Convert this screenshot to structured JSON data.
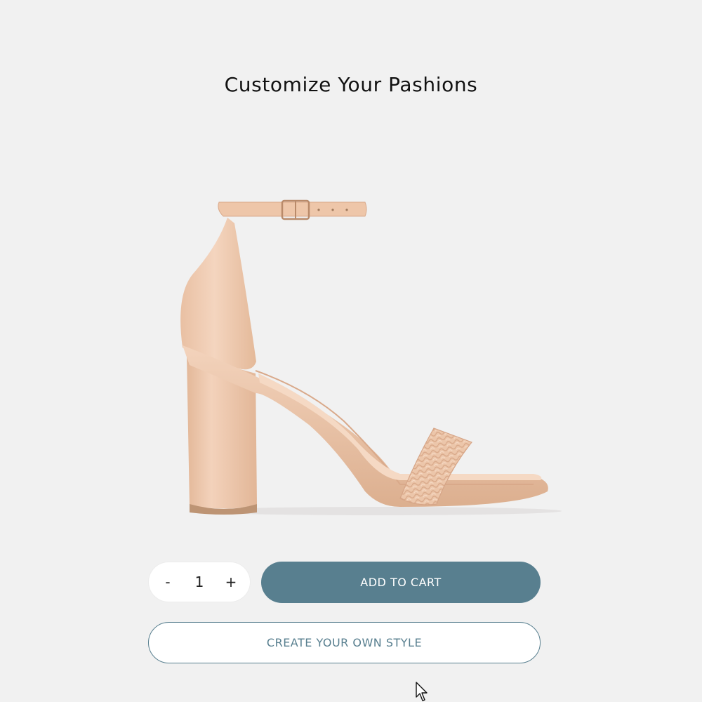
{
  "page": {
    "title": "Customize Your Pashions"
  },
  "product": {
    "image_icon": "high-heel-sandal",
    "color": "#eec9ad"
  },
  "quantity": {
    "decrement_label": "-",
    "value": "1",
    "increment_label": "+"
  },
  "actions": {
    "add_to_cart_label": "ADD TO CART",
    "create_style_label": "CREATE YOUR OWN STYLE"
  },
  "colors": {
    "background": "#f1f1f1",
    "accent": "#587f8f"
  }
}
